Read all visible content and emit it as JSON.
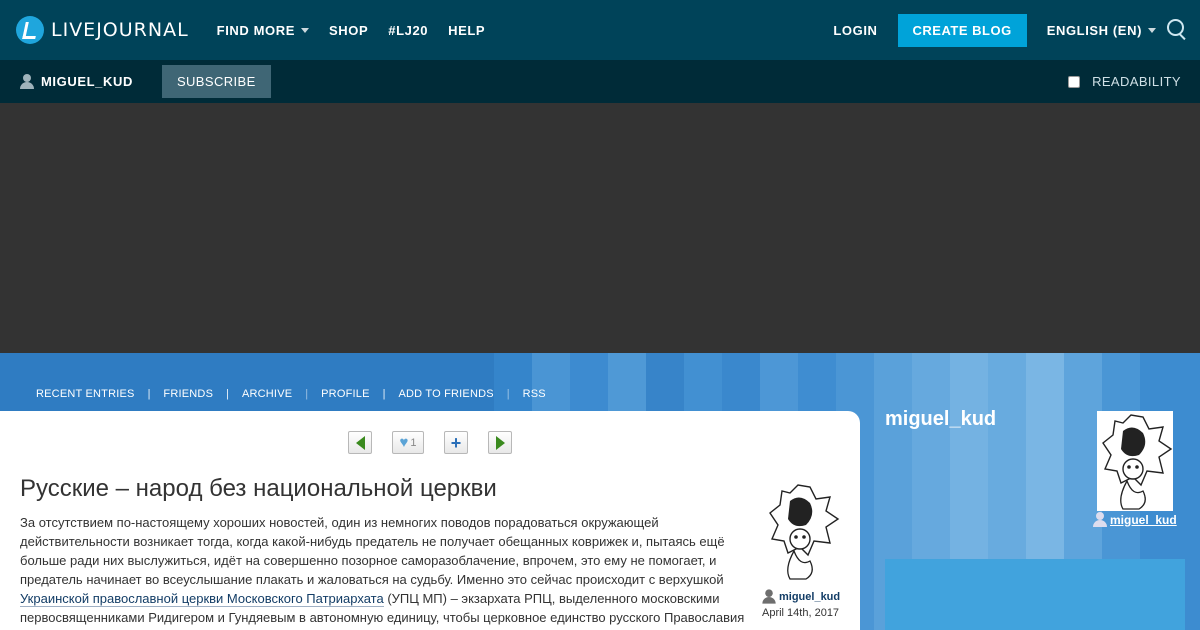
{
  "topbar": {
    "logo_text": "LIVEJOURNAL",
    "nav": [
      "FIND MORE",
      "SHOP",
      "#LJ20",
      "HELP"
    ],
    "login": "LOGIN",
    "create_blog": "CREATE BLOG",
    "language": "ENGLISH (EN)"
  },
  "subbar": {
    "username": "MIGUEL_KUD",
    "subscribe": "SUBSCRIBE",
    "readability": "READABILITY"
  },
  "journal_nav": [
    "RECENT ENTRIES",
    "FRIENDS",
    "ARCHIVE",
    "PROFILE",
    "ADD TO FRIENDS",
    "RSS"
  ],
  "post": {
    "like_count": "1",
    "title": "Русские – народ без национальной церкви",
    "body_before_link": "За отсутствием по-настоящему хороших новостей, один из немногих поводов порадоваться окружающей действительности возникает тогда, когда какой-нибудь предатель не получает обещанных коврижек и, пытаясь ещё больше ради них выслужиться, идёт на совершенно позорное саморазоблачение, впрочем, это ему не помогает, и предатель начинает во всеуслышание плакать и жаловаться на судьбу. Именно это сейчас происходит с верхушкой ",
    "body_link": "Украинской православной церкви Московского Патриархата",
    "body_after_link": " (УПЦ МП) – экзархата РПЦ, выделенного московскими первосвященниками Ридигером и Гундяевым в автономную единицу, чтобы церковное единство русского Православия",
    "author": "miguel_kud",
    "date": "April 14th, 2017"
  },
  "sidebar": {
    "journal_name": "miguel_kud",
    "user_link": "miguel_kud"
  },
  "colors": {
    "topbar": "#004359",
    "subbar": "#002b38",
    "create_blog": "#00a3d9",
    "journal_blue": "#2f7cc2",
    "sidebar_box": "#41a3dd"
  }
}
